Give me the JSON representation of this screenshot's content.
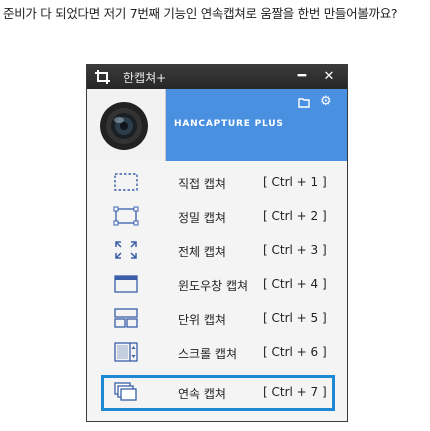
{
  "caption": "준비가 다 되었다면 저기 7번째 기능인 연속캡쳐로 움짤을 한번 만들어볼까요?",
  "window": {
    "title": "한캡쳐+",
    "brand": "HANCAPTURE PLUS",
    "minimize_label": "━",
    "close_label": "✕"
  },
  "menu": [
    {
      "label": "직접 캡쳐",
      "shortcut": "[ Ctrl + 1 ]",
      "icon": "direct-capture-icon"
    },
    {
      "label": "정밀 캡쳐",
      "shortcut": "[ Ctrl + 2 ]",
      "icon": "precise-capture-icon"
    },
    {
      "label": "전체 캡쳐",
      "shortcut": "[ Ctrl + 3 ]",
      "icon": "fullscreen-capture-icon"
    },
    {
      "label": "윈도우창 캡쳐",
      "shortcut": "[ Ctrl + 4 ]",
      "icon": "window-capture-icon"
    },
    {
      "label": "단위 캡쳐",
      "shortcut": "[ Ctrl + 5 ]",
      "icon": "unit-capture-icon"
    },
    {
      "label": "스크롤 캡쳐",
      "shortcut": "[ Ctrl + 6 ]",
      "icon": "scroll-capture-icon"
    },
    {
      "label": "연속 캡쳐",
      "shortcut": "[ Ctrl + 7 ]",
      "icon": "continuous-capture-icon"
    }
  ],
  "colors": {
    "accent": "#4a90e0",
    "highlight": "#1e88d4",
    "titlebar": "#2d2d2d"
  }
}
